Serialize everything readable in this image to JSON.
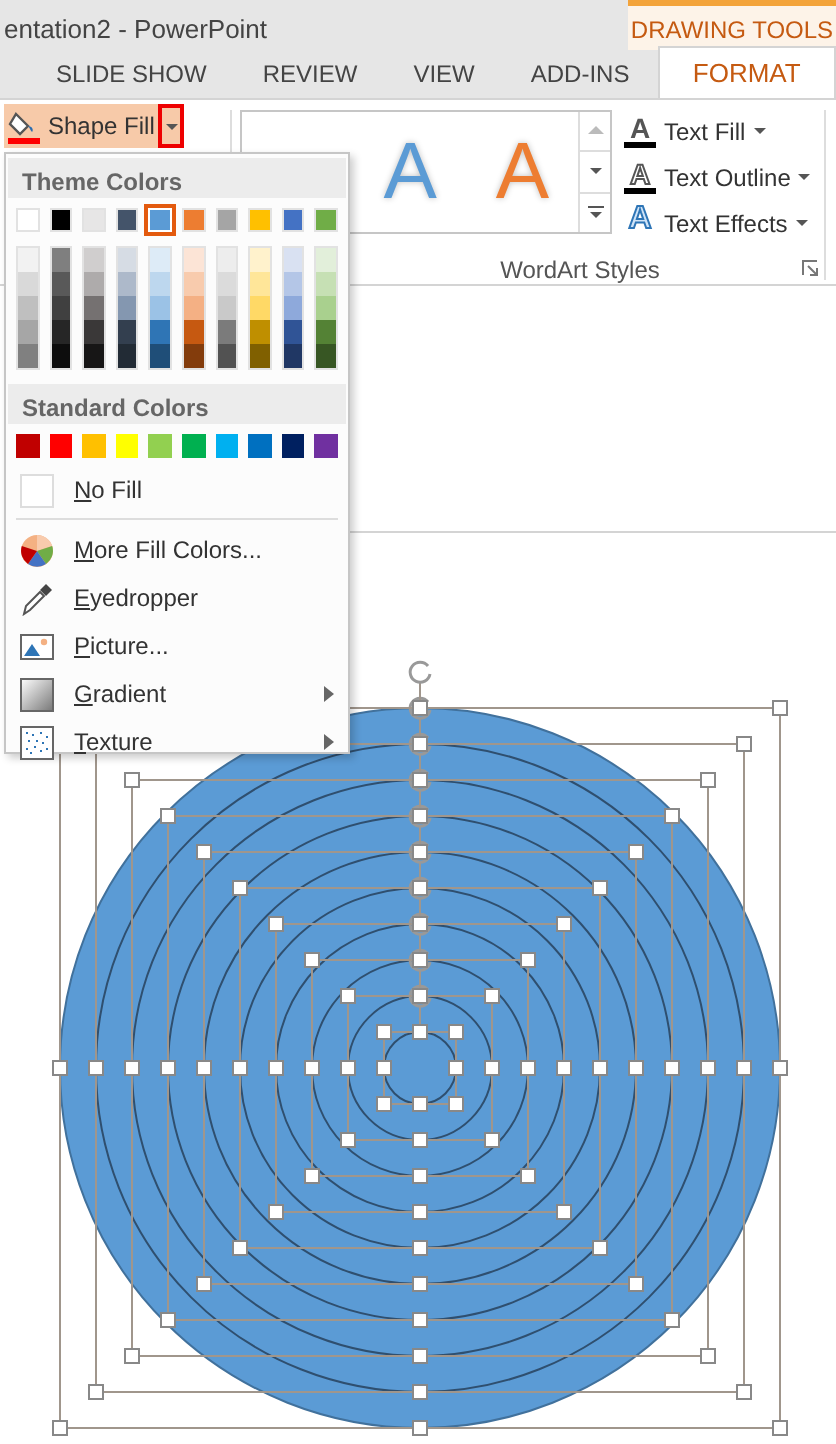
{
  "window": {
    "title": "entation2 - PowerPoint"
  },
  "contextual_tab": {
    "label": "DRAWING TOOLS"
  },
  "tabs": [
    {
      "label": "SLIDE SHOW",
      "selected": false
    },
    {
      "label": "REVIEW",
      "selected": false
    },
    {
      "label": "VIEW",
      "selected": false
    },
    {
      "label": "ADD-INS",
      "selected": false
    },
    {
      "label": "FORMAT",
      "selected": true
    }
  ],
  "shape_fill": {
    "label": "Shape Fill",
    "color": "#ff0000",
    "pressed": true,
    "dropdown_highlighted": true
  },
  "wordart_gallery": [
    {
      "glyph": "A",
      "color": "#5b9bd5"
    },
    {
      "glyph": "A",
      "color": "#ed7d31"
    }
  ],
  "text_buttons": [
    {
      "kind": "fill",
      "glyph": "A",
      "label": "Text Fill",
      "color": "#000000"
    },
    {
      "kind": "outline",
      "glyph": "A",
      "label": "Text Outline",
      "color": "#000000"
    },
    {
      "kind": "effects",
      "glyph": "A",
      "label": "Text Effects"
    }
  ],
  "group_label": "WordArt Styles",
  "menu": {
    "theme_heading": "Theme Colors",
    "theme_colors": [
      {
        "color": "#ffffff",
        "selected": false
      },
      {
        "color": "#000000",
        "selected": false
      },
      {
        "color": "#e7e6e6",
        "selected": false
      },
      {
        "color": "#44546a",
        "selected": false
      },
      {
        "color": "#5b9bd5",
        "selected": true
      },
      {
        "color": "#ed7d31",
        "selected": false
      },
      {
        "color": "#a5a5a5",
        "selected": false
      },
      {
        "color": "#ffc000",
        "selected": false
      },
      {
        "color": "#4472c4",
        "selected": false
      },
      {
        "color": "#70ad47",
        "selected": false
      }
    ],
    "shades": [
      [
        {
          "color": "#f2f2f2"
        },
        {
          "color": "#7f7f7f"
        },
        {
          "color": "#d0cece"
        },
        {
          "color": "#d6dce4"
        },
        {
          "color": "#ddebf7"
        },
        {
          "color": "#fce4d6"
        },
        {
          "color": "#ededed"
        },
        {
          "color": "#fff2cc"
        },
        {
          "color": "#d9e1f2"
        },
        {
          "color": "#e2efda"
        }
      ],
      [
        {
          "color": "#d9d9d9"
        },
        {
          "color": "#595959"
        },
        {
          "color": "#aeabab"
        },
        {
          "color": "#adb9ca"
        },
        {
          "color": "#bdd7ee"
        },
        {
          "color": "#f8cbad"
        },
        {
          "color": "#dbdbdb"
        },
        {
          "color": "#ffe699"
        },
        {
          "color": "#b4c6e7"
        },
        {
          "color": "#c6e0b4"
        }
      ],
      [
        {
          "color": "#bfbfbf"
        },
        {
          "color": "#404040"
        },
        {
          "color": "#757171"
        },
        {
          "color": "#8497b0"
        },
        {
          "color": "#9bc2e6"
        },
        {
          "color": "#f4b084"
        },
        {
          "color": "#c9c9c9"
        },
        {
          "color": "#ffd966"
        },
        {
          "color": "#8ea9db"
        },
        {
          "color": "#a9d08e"
        }
      ],
      [
        {
          "color": "#a6a6a6"
        },
        {
          "color": "#262626"
        },
        {
          "color": "#3a3838"
        },
        {
          "color": "#333f4f"
        },
        {
          "color": "#2f75b5"
        },
        {
          "color": "#c65911"
        },
        {
          "color": "#7b7b7b"
        },
        {
          "color": "#bf8f00"
        },
        {
          "color": "#305496"
        },
        {
          "color": "#548235"
        }
      ],
      [
        {
          "color": "#808080"
        },
        {
          "color": "#0d0d0d"
        },
        {
          "color": "#171616"
        },
        {
          "color": "#222b35"
        },
        {
          "color": "#1f4e78"
        },
        {
          "color": "#833c0c"
        },
        {
          "color": "#525252"
        },
        {
          "color": "#806000"
        },
        {
          "color": "#203764"
        },
        {
          "color": "#375623"
        }
      ]
    ],
    "standard_heading": "Standard Colors",
    "standard_colors": [
      {
        "color": "#c00000"
      },
      {
        "color": "#ff0000"
      },
      {
        "color": "#ffc000"
      },
      {
        "color": "#ffff00"
      },
      {
        "color": "#92d050"
      },
      {
        "color": "#00b050"
      },
      {
        "color": "#00b0f0"
      },
      {
        "color": "#0070c0"
      },
      {
        "color": "#002060"
      },
      {
        "color": "#7030a0"
      }
    ],
    "no_fill": "No Fill",
    "items": [
      {
        "kind": "colors",
        "label": "More Fill Colors...",
        "submenu": false
      },
      {
        "kind": "eyedropper",
        "label": "Eyedropper",
        "submenu": false
      },
      {
        "kind": "picture",
        "label": "Picture...",
        "submenu": false
      },
      {
        "kind": "gradient",
        "label": "Gradient",
        "submenu": true
      },
      {
        "kind": "texture",
        "label": "Texture",
        "submenu": true
      }
    ]
  }
}
